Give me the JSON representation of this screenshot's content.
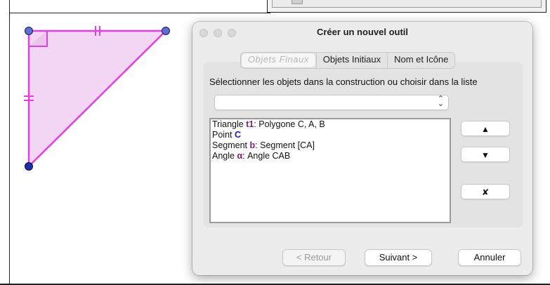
{
  "dialog": {
    "title": "Créer un nouvel outil",
    "tabs": [
      {
        "label": "Objets Finaux",
        "selected": true
      },
      {
        "label": "Objets Initiaux",
        "selected": false
      },
      {
        "label": "Nom et Icône",
        "selected": false
      }
    ],
    "instruction": "Sélectionner les objets dans la construction ou choisir dans la liste",
    "combo_value": "",
    "list_items": [
      {
        "prefix": "Triangle ",
        "name": "t1",
        "suffix": ": Polygone C, A, B",
        "color": "#7a1f7a"
      },
      {
        "prefix": "Point ",
        "name": "C",
        "suffix": "",
        "color": "#1a1ab8"
      },
      {
        "prefix": "Segment ",
        "name": "b",
        "suffix": ": Segment [CA]",
        "color": "#7a1f7a"
      },
      {
        "prefix": "Angle ",
        "name": "α",
        "suffix": ": Angle CAB",
        "color": "#7a1f7a"
      }
    ],
    "side_buttons": {
      "up": "▲",
      "down": "▼",
      "remove": "✘"
    },
    "footer": {
      "back": "< Retour",
      "next": "Suivant >",
      "cancel": "Annuler"
    }
  },
  "geometry": {
    "triangle_color": "#e040e0",
    "fill_color": "#f3d6f3",
    "point_color": "#5b6fd8",
    "dark_point_color": "#1a2fa8"
  }
}
